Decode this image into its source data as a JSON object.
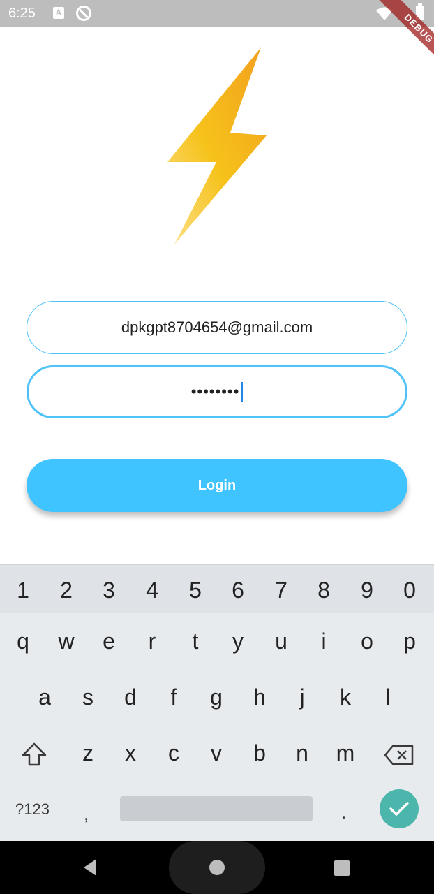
{
  "status_bar": {
    "time": "6:25",
    "notification_icon_a": "A",
    "icons": [
      "font-notification-icon",
      "sync-off-icon",
      "wifi-icon",
      "battery-icon"
    ]
  },
  "debug_banner": "DEBUG",
  "logo": {
    "icon": "lightning-bolt-icon",
    "color": "#f5b300"
  },
  "form": {
    "email_value": "dpkgpt8704654@gmail.com",
    "password_value": "••••••••",
    "accent_color": "#4fc3f7"
  },
  "login_button": {
    "label": "Login",
    "color": "#40c4ff"
  },
  "keyboard": {
    "number_row": [
      "1",
      "2",
      "3",
      "4",
      "5",
      "6",
      "7",
      "8",
      "9",
      "0"
    ],
    "row1": [
      "q",
      "w",
      "e",
      "r",
      "t",
      "y",
      "u",
      "i",
      "o",
      "p"
    ],
    "row2": [
      "a",
      "s",
      "d",
      "f",
      "g",
      "h",
      "j",
      "k",
      "l"
    ],
    "row3": [
      "z",
      "x",
      "c",
      "v",
      "b",
      "n",
      "m"
    ],
    "symbols_label": "?123",
    "comma": ",",
    "period": ".",
    "icons": [
      "shift-icon",
      "backspace-icon",
      "checkmark-icon"
    ],
    "enter_color": "#4db6ac"
  },
  "nav_bar": {
    "icons": [
      "back-icon",
      "home-icon",
      "recents-icon"
    ]
  }
}
